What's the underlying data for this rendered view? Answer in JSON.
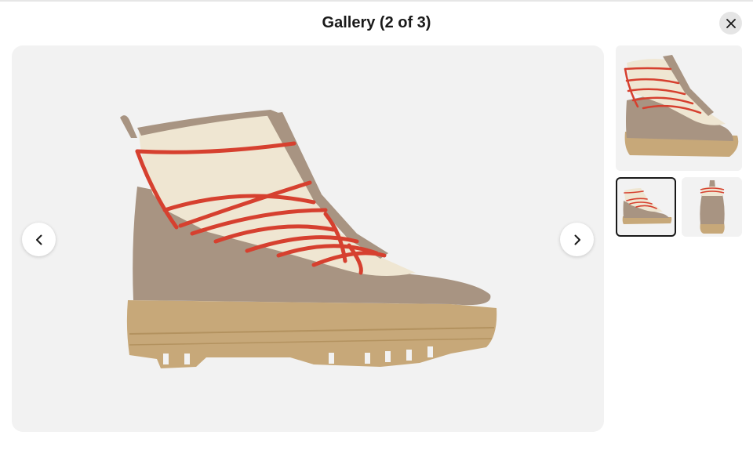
{
  "gallery": {
    "title": "Gallery (2 of 3)",
    "current_index": 2,
    "total": 3
  },
  "icons": {
    "close": "close-icon",
    "previous": "chevron-left-icon",
    "next": "chevron-right-icon"
  },
  "main_image": {
    "alt": "Tan suede and cream hiking boot with red laces, side view"
  },
  "thumbnails": [
    {
      "alt": "Boot angled three-quarter view",
      "selected": false
    },
    {
      "alt": "Boot side view",
      "selected": true
    },
    {
      "alt": "Boot back view",
      "selected": false
    }
  ],
  "colors": {
    "canvas": "#f2f2f2",
    "suede": "#a89482",
    "sole": "#c7a879",
    "cream": "#efe6d2",
    "lace": "#d6402f",
    "selected_border": "#191919"
  }
}
